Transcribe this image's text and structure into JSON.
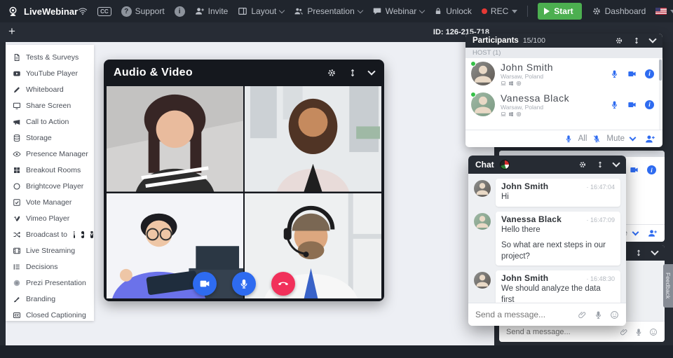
{
  "navbar": {
    "brand": "LiveWebinar",
    "cc_glyph": "CC",
    "question_glyph": "?",
    "support": "Support",
    "info_glyph": "i",
    "invite": "Invite",
    "layout": "Layout",
    "presentation": "Presentation",
    "webinar": "Webinar",
    "unlock": "Unlock",
    "rec": "REC",
    "start": "Start",
    "dashboard": "Dashboard"
  },
  "tab_bar": {
    "add_tab": "+",
    "session_id": "ID: 126-215-718"
  },
  "sidebar": {
    "items": [
      {
        "label": "Tests & Surveys",
        "icon": "document-icon"
      },
      {
        "label": "YouTube Player",
        "icon": "youtube-icon"
      },
      {
        "label": "Whiteboard",
        "icon": "pen-icon"
      },
      {
        "label": "Share Screen",
        "icon": "monitor-icon"
      },
      {
        "label": "Call to Action",
        "icon": "megaphone-icon"
      },
      {
        "label": "Storage",
        "icon": "database-icon"
      },
      {
        "label": "Presence Manager",
        "icon": "eye-icon"
      },
      {
        "label": "Breakout Rooms",
        "icon": "grid-icon"
      },
      {
        "label": "Brightcove Player",
        "icon": "circle-icon"
      },
      {
        "label": "Vote Manager",
        "icon": "check-square-icon"
      },
      {
        "label": "Vimeo Player",
        "icon": "vimeo-icon"
      },
      {
        "label": "Broadcast to",
        "icon": "shuffle-icon",
        "brands": [
          "f",
          "▸",
          "v"
        ]
      },
      {
        "label": "Live Streaming",
        "icon": "film-icon"
      },
      {
        "label": "Decisions",
        "icon": "list-icon"
      },
      {
        "label": "Prezi Presentation",
        "icon": "prezi-icon"
      },
      {
        "label": "Branding",
        "icon": "brush-icon"
      },
      {
        "label": "Closed Captioning",
        "icon": "cc-icon"
      }
    ]
  },
  "av_window": {
    "title": "Audio & Video"
  },
  "participants": {
    "title": "Participants",
    "count": "15/100",
    "host_section": "HOST (1)",
    "members": [
      {
        "name": "John Smith",
        "location": "Warsaw, Poland"
      },
      {
        "name": "Vanessa Black",
        "location": "Warsaw, Poland"
      }
    ],
    "footer": {
      "all": "All",
      "mute": "Mute"
    }
  },
  "attendees": {
    "footer_mute": "Mute"
  },
  "chat": {
    "title": "Chat",
    "messages": [
      {
        "author": "John Smith",
        "time": "· 16:47:04",
        "lines": [
          "Hi"
        ]
      },
      {
        "author": "Vanessa Black",
        "time": "· 16:47:09",
        "lines": [
          "Hello there",
          "So what are next steps in our project?"
        ]
      },
      {
        "author": "John Smith",
        "time": "· 16:48:30",
        "lines": [
          "We should analyze the data first"
        ]
      }
    ],
    "input_placeholder": "Send a message..."
  },
  "docked_chat": {
    "input_placeholder": "Send a message..."
  },
  "feedback_label": "Feedback",
  "colors": {
    "accent_blue": "#2e6bf0",
    "start_green": "#4caf50",
    "rec_red": "#e53935",
    "hangup_red": "#f1305a"
  }
}
